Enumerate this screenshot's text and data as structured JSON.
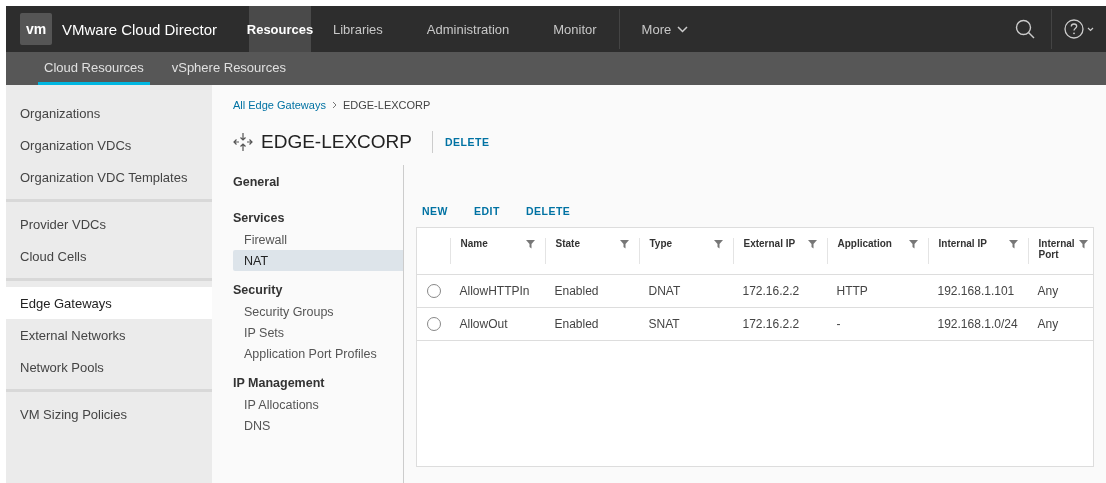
{
  "header": {
    "logo": "vm",
    "product": "VMware Cloud Director",
    "nav": [
      {
        "label": "Resources",
        "selected": true
      },
      {
        "label": "Libraries",
        "selected": false
      },
      {
        "label": "Administration",
        "selected": false
      },
      {
        "label": "Monitor",
        "selected": false
      }
    ],
    "more": "More"
  },
  "subnav": [
    {
      "label": "Cloud Resources",
      "selected": true
    },
    {
      "label": "vSphere Resources",
      "selected": false
    }
  ],
  "sidebar": {
    "groups": [
      {
        "items": [
          {
            "label": "Organizations",
            "selected": false
          },
          {
            "label": "Organization VDCs",
            "selected": false
          },
          {
            "label": "Organization VDC Templates",
            "selected": false
          }
        ]
      },
      {
        "items": [
          {
            "label": "Provider VDCs",
            "selected": false
          },
          {
            "label": "Cloud Cells",
            "selected": false
          }
        ]
      },
      {
        "items": [
          {
            "label": "Edge Gateways",
            "selected": true
          },
          {
            "label": "External Networks",
            "selected": false
          },
          {
            "label": "Network Pools",
            "selected": false
          }
        ]
      },
      {
        "items": [
          {
            "label": "VM Sizing Policies",
            "selected": false
          }
        ]
      }
    ]
  },
  "breadcrumb": {
    "link": "All Edge Gateways",
    "current": "EDGE-LEXCORP"
  },
  "title": "EDGE-LEXCORP",
  "title_action": "DELETE",
  "sections": [
    {
      "heading": "General"
    },
    {
      "heading": "Services",
      "items": [
        {
          "label": "Firewall",
          "selected": false
        },
        {
          "label": "NAT",
          "selected": true
        }
      ]
    },
    {
      "heading": "Security",
      "items": [
        {
          "label": "Security Groups",
          "selected": false
        },
        {
          "label": "IP Sets",
          "selected": false
        },
        {
          "label": "Application Port Profiles",
          "selected": false
        }
      ]
    },
    {
      "heading": "IP Management",
      "items": [
        {
          "label": "IP Allocations",
          "selected": false
        },
        {
          "label": "DNS",
          "selected": false
        }
      ]
    }
  ],
  "actions": [
    "NEW",
    "EDIT",
    "DELETE"
  ],
  "table": {
    "columns": [
      "Name",
      "State",
      "Type",
      "External IP",
      "Application",
      "Internal IP",
      "Internal Port"
    ],
    "rows": [
      {
        "selected": false,
        "cells": [
          "AllowHTTPIn",
          "Enabled",
          "DNAT",
          "172.16.2.2",
          "HTTP",
          "192.168.1.101",
          "Any"
        ]
      },
      {
        "selected": false,
        "cells": [
          "AllowOut",
          "Enabled",
          "SNAT",
          "172.16.2.2",
          "-",
          "192.168.1.0/24",
          "Any"
        ]
      }
    ]
  }
}
